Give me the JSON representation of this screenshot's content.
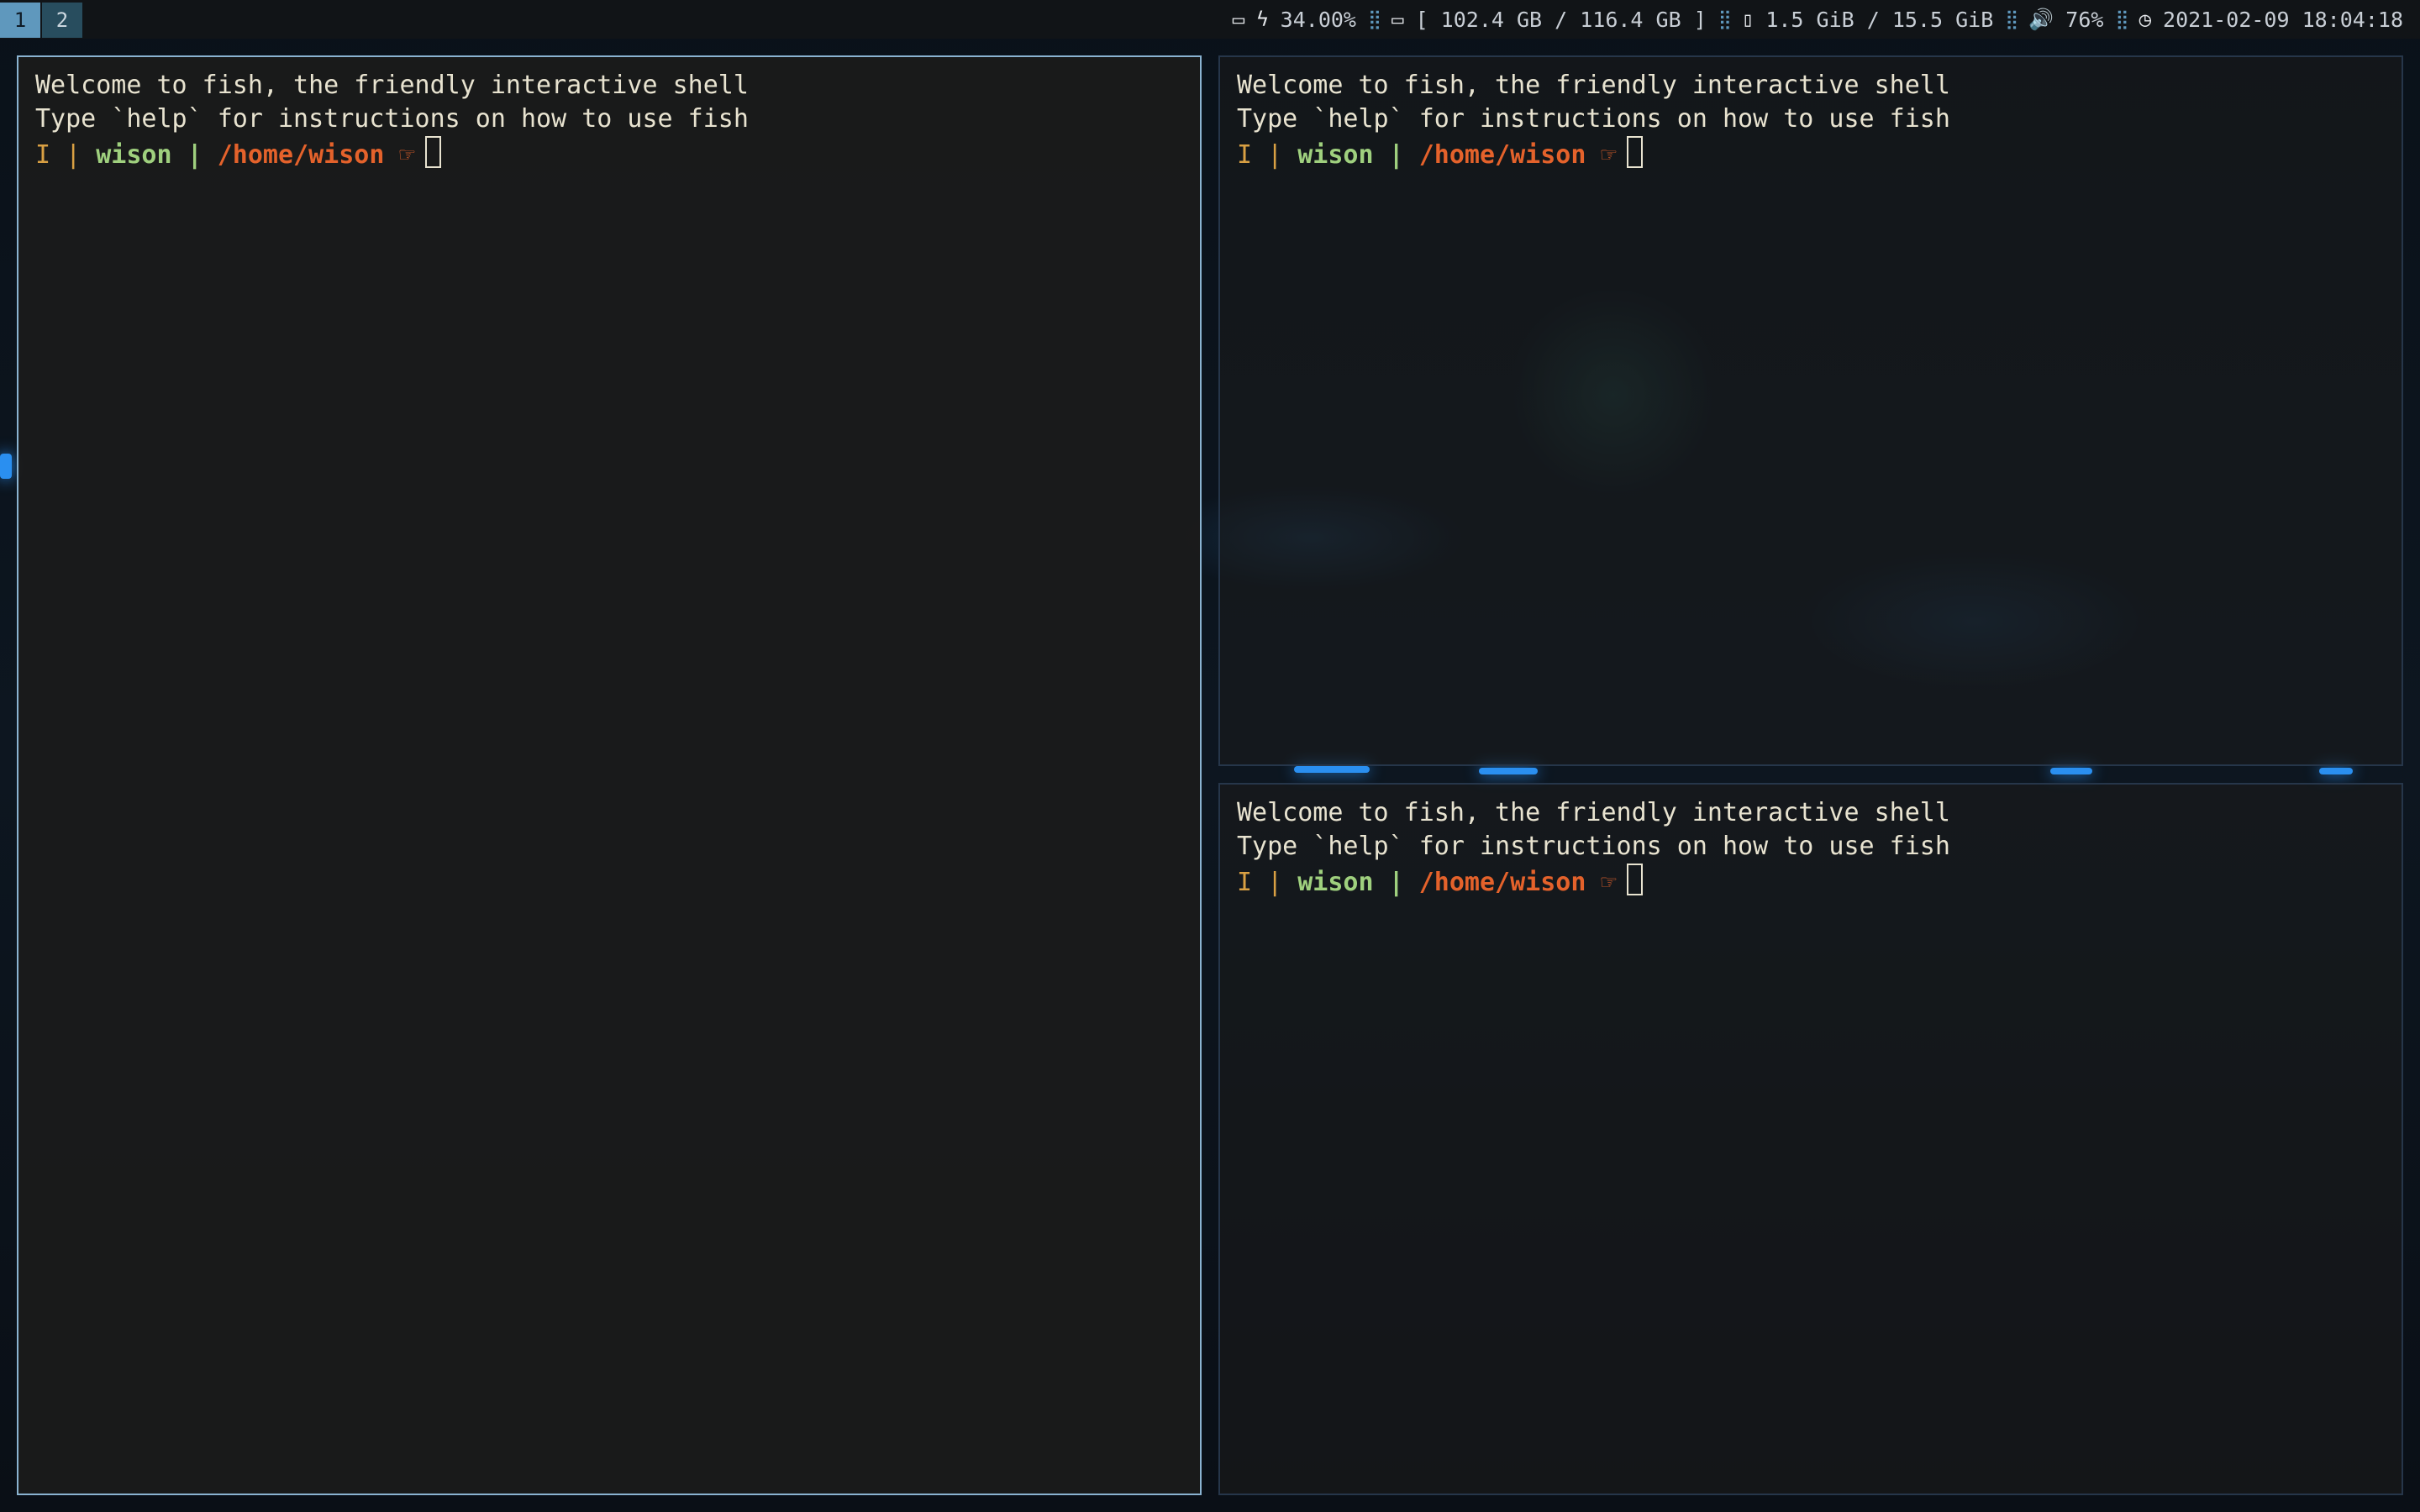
{
  "workspaces": [
    {
      "label": "1",
      "active": true
    },
    {
      "label": "2",
      "active": false
    }
  ],
  "status": {
    "battery_icon": "battery-icon",
    "charging_icon": "lightning-icon",
    "battery": "34.00%",
    "disk_icon": "hard-drive-icon",
    "disk": "[ 102.4 GB / 116.4 GB ]",
    "memory_icon": "memory-chip-icon",
    "memory": "1.5 GiB / 15.5 GiB",
    "volume_icon": "speaker-icon",
    "volume": "76%",
    "clock_icon": "clock-icon",
    "datetime": "2021-02-09 18:04:18",
    "separator": "⣿"
  },
  "terminals": [
    {
      "welcome": "Welcome to fish, the friendly interactive shell",
      "help": "Type `help` for instructions on how to use fish",
      "mode": "I",
      "divider": "|",
      "user": "wison",
      "path": "/home/wison",
      "hand": "☞"
    },
    {
      "welcome": "Welcome to fish, the friendly interactive shell",
      "help": "Type `help` for instructions on how to use fish",
      "mode": "I",
      "divider": "|",
      "user": "wison",
      "path": "/home/wison",
      "hand": "☞"
    },
    {
      "welcome": "Welcome to fish, the friendly interactive shell",
      "help": "Type `help` for instructions on how to use fish",
      "mode": "I",
      "divider": "|",
      "user": "wison",
      "path": "/home/wison",
      "hand": "☞"
    }
  ],
  "colors": {
    "focused_border": "#8ab3d1",
    "unfocused_border": "#26364a",
    "workspace_active": "#5f98bd",
    "prompt_user": "#9fd07e",
    "prompt_path": "#e4622b",
    "prompt_mode": "#d9a043"
  }
}
